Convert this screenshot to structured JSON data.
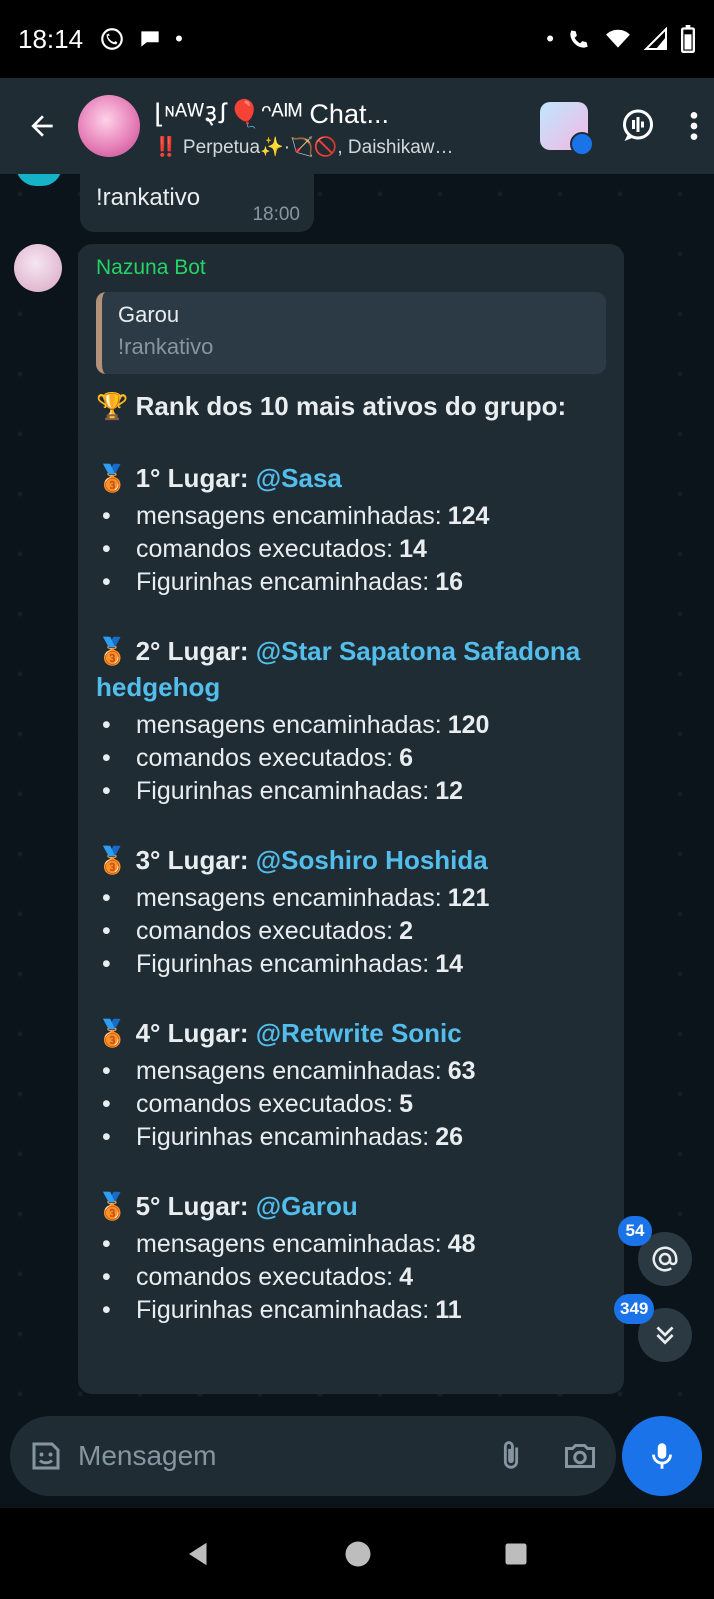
{
  "status_bar": {
    "time": "18:14"
  },
  "header": {
    "title": "⌊ᶰᴬᵂ३ꭍ🎈ᵔᴬᴵᴹ Chat...",
    "subtitle": "‼️ Perpetua✨·🏹🚫, Daishikawa,..."
  },
  "messages": {
    "prev": {
      "text": "!rankativo",
      "time": "18:00"
    },
    "bot": {
      "sender": "Nazuna Bot",
      "quote_name": "Garou",
      "quote_text": "!rankativo",
      "title": "🏆 Rank dos 10 mais ativos do grupo:",
      "label_msgs": "mensagens encaminhadas:",
      "label_cmds": "comandos executados:",
      "label_figs": "Figurinhas encaminhadas:",
      "ranks": [
        {
          "place": "🥉 1° Lugar:",
          "user": "@Sasa",
          "msgs": "124",
          "cmds": "14",
          "figs": "16"
        },
        {
          "place": "🥉 2° Lugar:",
          "user": "@Star Sapatona Safadona hedgehog",
          "msgs": "120",
          "cmds": "6",
          "figs": "12"
        },
        {
          "place": "🥉 3° Lugar:",
          "user": "@Soshiro Hoshida",
          "msgs": "121",
          "cmds": "2",
          "figs": "14"
        },
        {
          "place": "🥉 4° Lugar:",
          "user": "@Retwrite Sonic",
          "msgs": "63",
          "cmds": "5",
          "figs": "26"
        },
        {
          "place": "🥉 5° Lugar:",
          "user": "@Garou",
          "msgs": "48",
          "cmds": "4",
          "figs": "11"
        }
      ]
    }
  },
  "badges": {
    "mentions": "54",
    "unread": "349"
  },
  "input": {
    "placeholder": "Mensagem"
  },
  "colors": {
    "accent": "#1a73e8",
    "sender_green": "#25d366",
    "mention_blue": "#53bdeb",
    "bubble": "#1f2c34"
  }
}
